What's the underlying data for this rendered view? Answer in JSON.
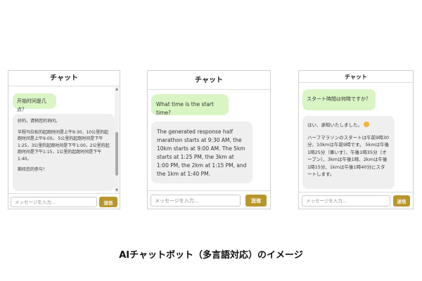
{
  "panels": [
    {
      "header": "チャット",
      "user_message": "开始时间是几点？",
      "bot_paragraphs": [
        "好的，请稍您的询问。",
        "半程马拉松的起跑时间是上午9:30，10公里的起跑时间是上午9:00。 5公里的起跑时间是下午1:25，3公里的起跑时间是下午1:00，2公里的起跑时间是下午1:15，1公里的起跑时间是下午1:40。",
        "期待您的参与！"
      ],
      "input_placeholder": "メッセージを入力...",
      "send_label": "送信"
    },
    {
      "header": "チャット",
      "user_message": "What time is the start time?",
      "bot_paragraphs": [
        "The generated response half marathon starts at 9:30 AM, the 10km starts at 9:00 AM. The 5km starts at 1:25 PM, the 3km at 1:00 PM, the 2km at 1:15 PM, and the 1km at 1:40 PM."
      ],
      "input_placeholder": "メッセージを入力...",
      "send_label": "送信"
    },
    {
      "header": "チャット",
      "user_message": "スタート時間は何時ですか？",
      "bot_paragraphs": [
        "はい、承知いたしました。",
        "ハーフマラソンのスタートは午前9時30分、10kmは午前9時です。 5kmは午後1時25分（車いす）、午後1時35分（オープン）、3kmは午後1時、2kmは午後1時15分、1kmは午後1時40分にスタートします。"
      ],
      "input_placeholder": "メッセージを入力...",
      "send_label": "送信"
    }
  ],
  "caption": "AIチャットボット（多言語対応）のイメージ",
  "colors": {
    "user_bubble": "#d9f5c4",
    "bot_bubble": "#efefef",
    "send_button": "#b9962c"
  }
}
